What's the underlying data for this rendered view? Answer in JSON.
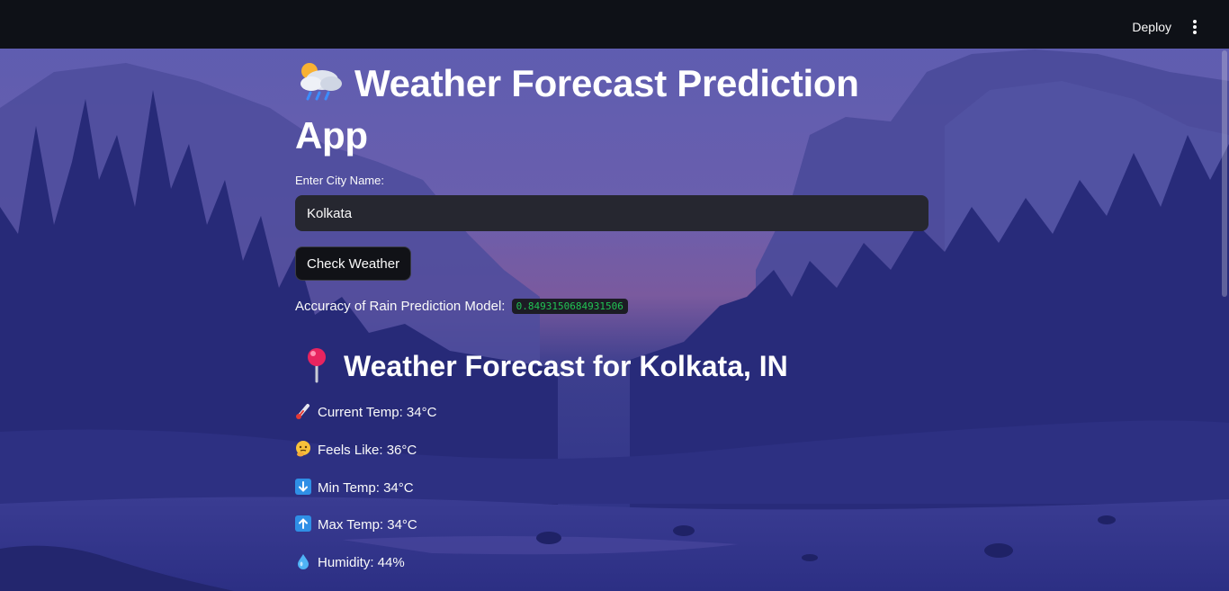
{
  "header": {
    "deploy_label": "Deploy",
    "menu_icon": "more-vertical-icon"
  },
  "main": {
    "title": "Weather Forecast Prediction App",
    "title_icon": "rain-cloud-icon",
    "city_label": "Enter City Name:",
    "city_value": "Kolkata",
    "button_label": "Check Weather",
    "accuracy_label": "Accuracy of Rain Prediction Model:",
    "accuracy_value": "0.8493150684931506",
    "forecast_heading": "Weather Forecast for Kolkata, IN",
    "forecast_icon": "location-pin-icon",
    "stats": [
      {
        "icon": "thermometer-icon",
        "text": "Current Temp: 34°C"
      },
      {
        "icon": "thinking-face-icon",
        "text": "Feels Like: 36°C"
      },
      {
        "icon": "down-arrow-icon",
        "text": "Min Temp: 34°C"
      },
      {
        "icon": "up-arrow-icon",
        "text": "Max Temp: 34°C"
      },
      {
        "icon": "droplet-icon",
        "text": "Humidity: 44%"
      }
    ]
  },
  "colors": {
    "header_bg": "#0e1117",
    "input_bg": "#262730",
    "code_text": "#21c354",
    "button_bg": "#111217"
  }
}
